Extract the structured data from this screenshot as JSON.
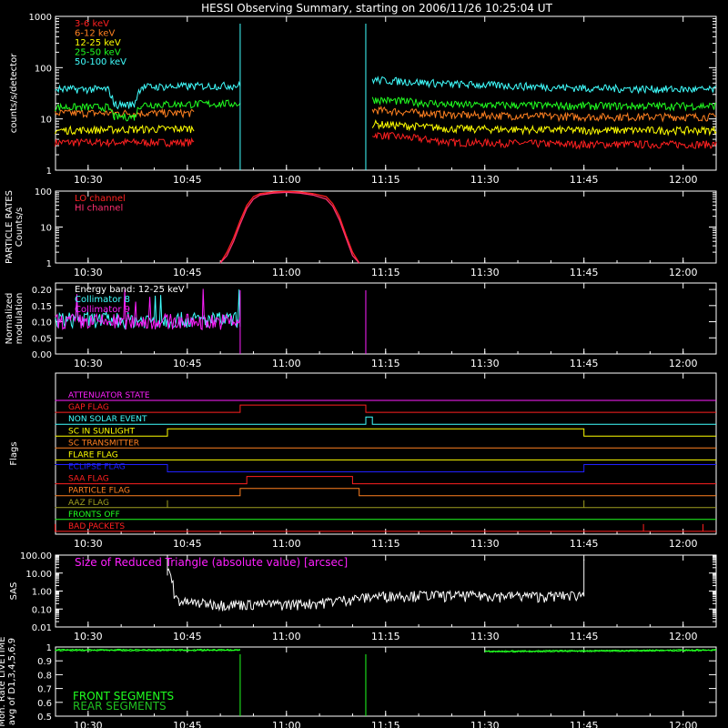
{
  "title": "HESSI Observing Summary, starting on 2006/11/26 10:25:04 UT",
  "time_axis": {
    "start": "10:25:04",
    "end": "12:05:00",
    "tick_labels": [
      "10:30",
      "10:45",
      "11:00",
      "11:15",
      "11:30",
      "11:45",
      "12:00"
    ],
    "tick_times": [
      "10:30",
      "10:45",
      "11:00",
      "11:15",
      "11:30",
      "11:45",
      "12:00"
    ]
  },
  "colors": {
    "background": "#000000",
    "axis": "#ffffff",
    "red": "#ff2020",
    "orange": "#ff8020",
    "yellow": "#ffff00",
    "green": "#20ff20",
    "cyan": "#40ffff",
    "magenta": "#ff20ff",
    "blue": "#2020ff",
    "pink": "#ff3070",
    "olive": "#a0a020",
    "white": "#ffffff"
  },
  "chart_data": [
    {
      "type": "line",
      "id": "count-rates",
      "ylabel": "counts/s/detector",
      "yscale": "log",
      "ylim": [
        1,
        1000
      ],
      "ytick_labels": [
        "1",
        "10",
        "100",
        "1000"
      ],
      "legend_position": "top-left",
      "series": [
        {
          "name": "3-6 keV",
          "color": "red",
          "x": [
            "10:25",
            "10:46",
            "10:53",
            "11:12",
            "11:13",
            "11:25",
            "11:45",
            "12:05"
          ],
          "y": [
            3.5,
            3.5,
            null,
            null,
            5,
            3.5,
            3.2,
            3.2
          ]
        },
        {
          "name": "6-12 keV",
          "color": "orange",
          "x": [
            "10:25",
            "10:46",
            "10:53",
            "11:12",
            "11:13",
            "11:25",
            "11:45",
            "12:05"
          ],
          "y": [
            13,
            13,
            null,
            null,
            15,
            12,
            11,
            11
          ]
        },
        {
          "name": "12-25 keV",
          "color": "yellow",
          "x": [
            "10:25",
            "10:46",
            "10:53",
            "11:12",
            "11:13",
            "11:25",
            "11:45",
            "12:05"
          ],
          "y": [
            6,
            6.5,
            null,
            null,
            8,
            6.5,
            6,
            6
          ]
        },
        {
          "name": "25-50 keV",
          "color": "green",
          "x": [
            "10:25",
            "10:33",
            "10:34",
            "10:37",
            "10:38",
            "10:53",
            "11:12",
            "11:13",
            "11:25",
            "11:45",
            "12:05"
          ],
          "y": [
            17,
            17,
            11,
            11,
            19,
            20,
            null,
            24,
            19,
            18,
            18
          ]
        },
        {
          "name": "50-100 keV",
          "color": "cyan",
          "x": [
            "10:25",
            "10:33",
            "10:34",
            "10:37",
            "10:38",
            "10:53",
            "11:12",
            "11:13",
            "11:25",
            "11:45",
            "12:05"
          ],
          "y": [
            38,
            38,
            19,
            19,
            42,
            45,
            null,
            58,
            48,
            40,
            37
          ]
        }
      ]
    },
    {
      "type": "line",
      "id": "particle-rates",
      "ylabel": "PARTICLE RATES Counts/s",
      "yscale": "log",
      "ylim": [
        1,
        100
      ],
      "ytick_labels": [
        "1",
        "10",
        "100"
      ],
      "legend_position": "top-left",
      "series": [
        {
          "name": "LO channel",
          "color": "red",
          "x": [
            "10:50",
            "10:51",
            "10:52",
            "10:53",
            "10:54",
            "10:55",
            "10:56",
            "10:58",
            "11:00",
            "11:02",
            "11:04",
            "11:06",
            "11:07",
            "11:08",
            "11:09",
            "11:10",
            "11:11"
          ],
          "y": [
            1,
            2,
            5,
            15,
            40,
            70,
            85,
            95,
            98,
            95,
            85,
            70,
            45,
            20,
            6,
            2,
            1
          ]
        },
        {
          "name": "HI channel",
          "color": "pink",
          "x": [
            "10:50",
            "10:51",
            "10:52",
            "10:53",
            "10:54",
            "10:55",
            "10:56",
            "10:58",
            "11:00",
            "11:02",
            "11:04",
            "11:06",
            "11:07",
            "11:08",
            "11:09",
            "11:10",
            "11:11"
          ],
          "y": [
            1,
            1.6,
            4,
            12,
            33,
            60,
            78,
            88,
            92,
            88,
            78,
            60,
            38,
            16,
            5,
            1.6,
            1
          ]
        }
      ]
    },
    {
      "type": "line",
      "id": "modulation",
      "ylabel": "Normalized modulation",
      "ylim": [
        0,
        0.22
      ],
      "ytick_labels": [
        "0.00",
        "0.05",
        "0.10",
        "0.15",
        "0.20"
      ],
      "annotation": "Energy band: 12-25 keV",
      "legend_position": "top-left",
      "series": [
        {
          "name": "Collimator 8",
          "color": "cyan",
          "x": [
            "10:25",
            "10:53",
            "11:12",
            "12:05"
          ],
          "y": [
            0.105,
            0.105,
            null,
            0.11
          ]
        },
        {
          "name": "Collimator 9",
          "color": "magenta",
          "x": [
            "10:25",
            "10:53",
            "11:12",
            "12:05"
          ],
          "y": [
            0.1,
            0.1,
            null,
            0.1
          ]
        }
      ]
    },
    {
      "type": "line",
      "id": "flags",
      "ylabel": "Flags",
      "series": [
        {
          "name": "ATTENUATOR STATE",
          "color": "magenta",
          "x": [
            "10:25",
            "12:05"
          ],
          "y": [
            0,
            0
          ]
        },
        {
          "name": "GAP FLAG",
          "color": "red",
          "x": [
            "10:25",
            "10:53",
            "10:53",
            "11:12",
            "11:12",
            "12:05"
          ],
          "y": [
            0,
            0,
            1,
            1,
            0,
            0
          ]
        },
        {
          "name": "NON SOLAR EVENT",
          "color": "cyan",
          "x": [
            "10:25",
            "11:12",
            "11:12",
            "11:13",
            "11:13",
            "12:05"
          ],
          "y": [
            0,
            0,
            1,
            1,
            0,
            0
          ]
        },
        {
          "name": "SC IN SUNLIGHT",
          "color": "yellow",
          "x": [
            "10:25",
            "10:42",
            "10:42",
            "11:45",
            "11:45",
            "12:05"
          ],
          "y": [
            0,
            0,
            1,
            1,
            0,
            0
          ]
        },
        {
          "name": "SC TRANSMITTER",
          "color": "orange",
          "x": [
            "10:25",
            "12:05"
          ],
          "y": [
            0,
            0
          ]
        },
        {
          "name": "FLARE FLAG",
          "color": "yellow",
          "x": [
            "10:25",
            "12:05"
          ],
          "y": [
            0,
            0
          ]
        },
        {
          "name": "ECLIPSE FLAG",
          "color": "blue",
          "x": [
            "10:25",
            "10:42",
            "10:42",
            "11:45",
            "11:45",
            "12:05"
          ],
          "y": [
            1,
            1,
            0,
            0,
            1,
            1
          ]
        },
        {
          "name": "SAA FLAG",
          "color": "red",
          "x": [
            "10:25",
            "10:54",
            "10:54",
            "11:10",
            "11:10",
            "12:05"
          ],
          "y": [
            0,
            0,
            1,
            1,
            0,
            0
          ]
        },
        {
          "name": "PARTICLE FLAG",
          "color": "orange",
          "x": [
            "10:25",
            "10:53",
            "10:53",
            "11:11",
            "11:11",
            "12:05"
          ],
          "y": [
            0,
            0,
            1,
            1,
            0,
            0
          ]
        },
        {
          "name": "AAZ FLAG",
          "color": "olive",
          "x": [
            "10:25",
            "10:42",
            "10:42",
            "10:42",
            "10:42",
            "11:45",
            "11:45",
            "11:45",
            "11:45",
            "12:05"
          ],
          "y": [
            0,
            0,
            1,
            1,
            0,
            0,
            1,
            1,
            0,
            0
          ]
        },
        {
          "name": "FRONTS OFF",
          "color": "green",
          "x": [
            "10:25",
            "12:05"
          ],
          "y": [
            0,
            0
          ]
        },
        {
          "name": "BAD PACKETS",
          "color": "red",
          "x": [
            "10:25",
            "10:25",
            "10:25",
            "11:54",
            "11:54",
            "11:54",
            "12:03",
            "12:03",
            "12:03",
            "12:05"
          ],
          "y": [
            1,
            1,
            0,
            0,
            1,
            0,
            0,
            1,
            0,
            0
          ]
        }
      ]
    },
    {
      "type": "line",
      "id": "sas",
      "ylabel": "SAS",
      "yscale": "log",
      "ylim": [
        0.01,
        100
      ],
      "ytick_labels": [
        "0.01",
        "0.10",
        "1.00",
        "10.00",
        "100.00"
      ],
      "annotation": "Size of Reduced Triangle (absolute value) [arcsec]",
      "series": [
        {
          "name": "triangle",
          "color": "white",
          "x": [
            "10:42",
            "10:42",
            "10:43",
            "10:44",
            "10:46",
            "10:50",
            "10:55",
            "11:00",
            "11:05",
            "11:10",
            "11:15",
            "11:20",
            "11:30",
            "11:40",
            "11:45",
            "11:45"
          ],
          "y": [
            100,
            10,
            0.4,
            0.2,
            0.18,
            0.15,
            0.15,
            0.15,
            0.18,
            0.3,
            0.45,
            0.48,
            0.45,
            0.42,
            0.5,
            100
          ]
        }
      ]
    },
    {
      "type": "line",
      "id": "livetime",
      "ylabel": "Mon. Rate LIVETIME avg of D1,3,4,5,6,9",
      "ylim": [
        0.5,
        1.0
      ],
      "ytick_labels": [
        "0.5",
        "0.6",
        "0.7",
        "0.8",
        "0.9",
        "1"
      ],
      "legend_position": "bottom-left",
      "series": [
        {
          "name": "FRONT SEGMENTS",
          "color": "green",
          "x": [
            "10:25",
            "10:53",
            "11:12",
            "11:30",
            "12:05"
          ],
          "y": [
            0.98,
            0.98,
            null,
            0.97,
            0.98
          ]
        },
        {
          "name": "REAR SEGMENTS",
          "color": "green",
          "x": [
            "10:25",
            "10:53",
            "11:12",
            "11:30",
            "12:05"
          ],
          "y": [
            0.975,
            0.975,
            null,
            0.965,
            0.975
          ]
        }
      ]
    }
  ]
}
